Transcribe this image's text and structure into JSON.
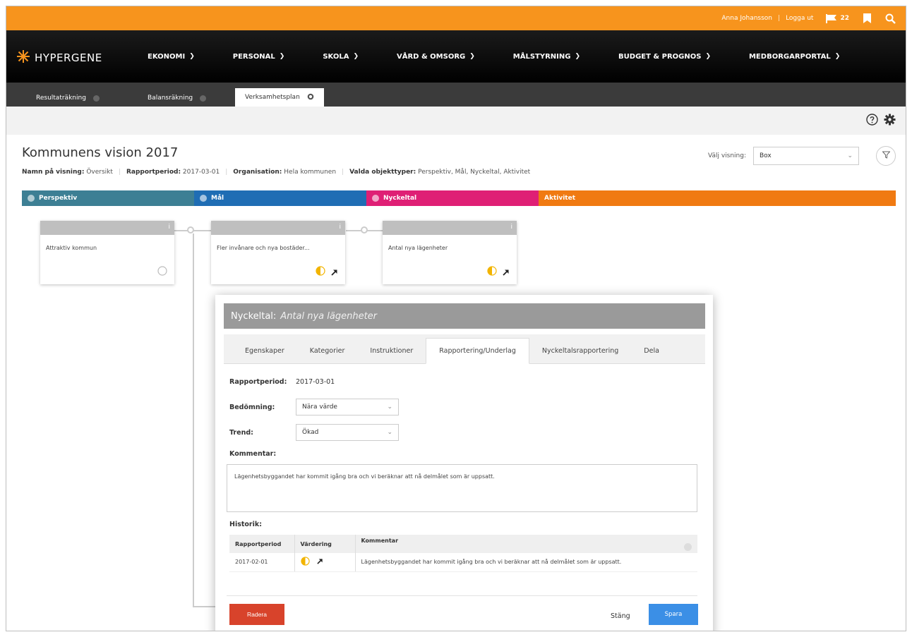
{
  "topbar": {
    "user_name": "Anna Johansson",
    "logout_label": "Logga ut",
    "notification_count": "22"
  },
  "logo": {
    "text": "HYPERGENE"
  },
  "nav": {
    "items": [
      {
        "label": "EKONOMI"
      },
      {
        "label": "PERSONAL"
      },
      {
        "label": "SKOLA"
      },
      {
        "label": "VÅRD & OMSORG"
      },
      {
        "label": "MÅLSTYRNING"
      },
      {
        "label": "BUDGET & PROGNOS"
      },
      {
        "label": "MEDBORGARPORTAL"
      }
    ]
  },
  "tabs": [
    {
      "label": "Resultaträkning"
    },
    {
      "label": "Balansräkning"
    },
    {
      "label": "Verksamhetsplan"
    }
  ],
  "page": {
    "title": "Kommunens vision 2017",
    "meta": {
      "view_label": "Namn på visning:",
      "view_value": "Översikt",
      "period_label": "Rapportperiod:",
      "period_value": "2017-03-01",
      "org_label": "Organisation:",
      "org_value": "Hela kommunen",
      "types_label": "Valda objekttyper:",
      "types_value": "Perspektiv, Mål, Nyckeltal, Aktivitet"
    },
    "view_select_label": "Välj visning:",
    "view_select_value": "Box"
  },
  "columns": [
    {
      "label": "Perspektiv",
      "color": "#3d7f94"
    },
    {
      "label": "Mål",
      "color": "#1f6db4"
    },
    {
      "label": "Nyckeltal",
      "color": "#df1f75"
    },
    {
      "label": "Aktivitet",
      "color": "#f07a12"
    }
  ],
  "cards": [
    {
      "text": "Attraktiv kommun"
    },
    {
      "text": "Fler invånare och nya bostäder..."
    },
    {
      "text": "Antal nya lägenheter"
    }
  ],
  "modal": {
    "title_prefix": "Nyckeltal:",
    "title_name": "Antal nya lägenheter",
    "tabs": [
      {
        "label": "Egenskaper"
      },
      {
        "label": "Kategorier"
      },
      {
        "label": "Instruktioner"
      },
      {
        "label": "Rapportering/Underlag"
      },
      {
        "label": "Nyckeltalsrapportering"
      },
      {
        "label": "Dela"
      }
    ],
    "period_label": "Rapportperiod:",
    "period_value": "2017-03-01",
    "assessment_label": "Bedömning:",
    "assessment_value": "Nära värde",
    "trend_label": "Trend:",
    "trend_value": "Ökad",
    "comment_label": "Kommentar:",
    "comment_value": "Lägenhetsbyggandet har kommit igång bra och vi beräknar att nå delmålet som är uppsatt.",
    "history_label": "Historik:",
    "history_headers": [
      "Rapportperiod",
      "Värdering",
      "Kommentar"
    ],
    "history_rows": [
      {
        "period": "2017-02-01",
        "comment": "Lägenhetsbyggandet har kommit igång bra och vi beräknar att nå delmålet som är uppsatt."
      }
    ],
    "delete_label": "Radera",
    "close_label": "Stäng",
    "save_label": "Spara"
  },
  "colors": {
    "topbar": "#f7941d",
    "delete": "#d8432b",
    "save": "#3b8fe6"
  }
}
